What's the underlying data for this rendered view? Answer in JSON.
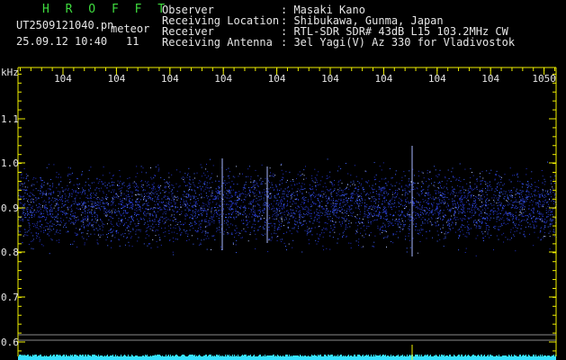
{
  "header": {
    "station_code": "H R O F F T",
    "filename": "UT2509121040.pn",
    "type_label": "meteor",
    "datetime": "25.09.12 10:40",
    "count": "11",
    "observer_label": "Observer",
    "observer_value": ": Masaki Kano",
    "location_label": "Receiving Location",
    "location_value": ": Shibukawa, Gunma, Japan",
    "receiver_label": "Receiver",
    "receiver_value": ": RTL-SDR SDR# 43dB L15 103.2MHz CW",
    "antenna_label": "Receiving Antenna",
    "antenna_value": ": 3el Yagi(V) Az 330 for Vladivostok"
  },
  "axes": {
    "y_unit": "kHz",
    "y_ticks": [
      "1.1",
      "1.0",
      "0.9",
      "0.8",
      "0.7",
      "0.6"
    ],
    "x_ticks": [
      "104",
      "104",
      "104",
      "104",
      "104",
      "104",
      "104",
      "104",
      "104",
      "1050"
    ]
  },
  "colors": {
    "axis": "#f0f000",
    "text": "#e6e6e6",
    "title": "#3fdc3f",
    "noise": "#2f4fff",
    "bottom_bar": "#35e0ff"
  }
}
